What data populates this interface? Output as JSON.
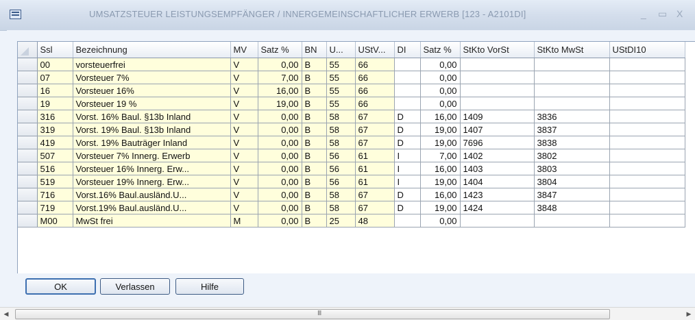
{
  "window": {
    "title": "UMSATZSTEUER LEISTUNGSEMPFÄNGER / INNERGEMEINSCHAFTLICHER ERWERB  [123 - A2101DI]",
    "app_icon": "table-icon",
    "controls": {
      "minimize": "_",
      "maximize": "▭",
      "close": "X"
    }
  },
  "table": {
    "columns": [
      "Ssl",
      "Bezeichnung",
      "MV",
      "Satz %",
      "BN",
      "U...",
      "UStV...",
      "DI",
      "Satz %",
      "StKto VorSt",
      "StKto MwSt",
      "UStDI10"
    ],
    "rows": [
      [
        "00",
        "vorsteuerfrei",
        "V",
        "0,00",
        "B",
        "55",
        "66",
        "",
        "0,00",
        "",
        "",
        ""
      ],
      [
        "07",
        "Vorsteuer 7%",
        "V",
        "7,00",
        "B",
        "55",
        "66",
        "",
        "0,00",
        "",
        "",
        ""
      ],
      [
        "16",
        "Vorsteuer 16%",
        "V",
        "16,00",
        "B",
        "55",
        "66",
        "",
        "0,00",
        "",
        "",
        ""
      ],
      [
        "19",
        "Vorsteuer 19 %",
        "V",
        "19,00",
        "B",
        "55",
        "66",
        "",
        "0,00",
        "",
        "",
        ""
      ],
      [
        "316",
        "Vorst. 16% Baul. §13b Inland",
        "V",
        "0,00",
        "B",
        "58",
        "67",
        "D",
        "16,00",
        "1409",
        "3836",
        ""
      ],
      [
        "319",
        "Vorst. 19% Baul. §13b Inland",
        "V",
        "0,00",
        "B",
        "58",
        "67",
        "D",
        "19,00",
        "1407",
        "3837",
        ""
      ],
      [
        "419",
        "Vorst. 19% Bauträger Inland",
        "V",
        "0,00",
        "B",
        "58",
        "67",
        "D",
        "19,00",
        "7696",
        "3838",
        ""
      ],
      [
        "507",
        "Vorsteuer  7% Innerg. Erwerb",
        "V",
        "0,00",
        "B",
        "56",
        "61",
        "I",
        "7,00",
        "1402",
        "3802",
        ""
      ],
      [
        "516",
        "Vorsteuer 16% Innerg. Erw...",
        "V",
        "0,00",
        "B",
        "56",
        "61",
        "I",
        "16,00",
        "1403",
        "3803",
        ""
      ],
      [
        "519",
        "Vorsteuer 19% Innerg. Erw...",
        "V",
        "0,00",
        "B",
        "56",
        "61",
        "I",
        "19,00",
        "1404",
        "3804",
        ""
      ],
      [
        "716",
        "Vorst.16% Baul.ausländ.U...",
        "V",
        "0,00",
        "B",
        "58",
        "67",
        "D",
        "16,00",
        "1423",
        "3847",
        ""
      ],
      [
        "719",
        "Vorst.19% Baul.ausländ.U...",
        "V",
        "0,00",
        "B",
        "58",
        "67",
        "D",
        "19,00",
        "1424",
        "3848",
        ""
      ],
      [
        "M00",
        "MwSt frei",
        "M",
        "0,00",
        "B",
        "25",
        "48",
        "",
        "0,00",
        "",
        "",
        ""
      ]
    ]
  },
  "buttons": {
    "ok": "OK",
    "verlassen": "Verlassen",
    "hilfe": "Hilfe"
  },
  "scrollbar": {
    "grip": "III"
  }
}
